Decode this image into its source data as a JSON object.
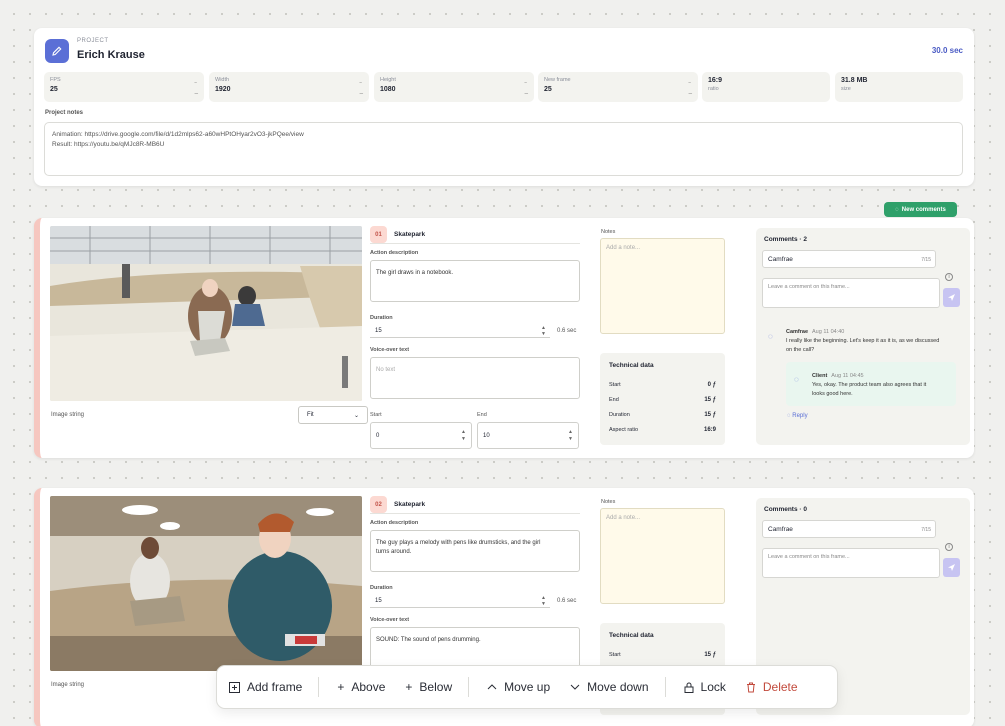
{
  "project": {
    "kicker": "PROJECT",
    "name": "Erich Krause",
    "duration": "30.0 sec",
    "stats": [
      {
        "label": "FPS",
        "value": "25"
      },
      {
        "label": "Width",
        "value": "1920"
      },
      {
        "label": "Height",
        "value": "1080"
      },
      {
        "label": "New frame",
        "value": "25"
      },
      {
        "label": "",
        "value": "16:9",
        "sub": "ratio"
      },
      {
        "label": "",
        "value": "31.8 MB",
        "sub": "size"
      }
    ],
    "notes_label": "Project notes",
    "notes_line1": "Animation: https://drive.google.com/file/d/1d2mlps62-a60wHPtOHyar2vO3-jkPQee/view",
    "notes_line2": "Result: https://youtu.be/qMJc8R-MB6U"
  },
  "new_comments_label": "New comments",
  "frames": [
    {
      "number": "01",
      "title": "Skatepark",
      "action_label": "Action description",
      "action_text": "The girl draws in a notebook.",
      "duration_label": "Duration",
      "duration": "15",
      "duration_sec": "0.6 sec",
      "vo_label": "Voice-over text",
      "vo_text": "No text",
      "start_label": "Start",
      "start": "0",
      "end_label": "End",
      "end": "10",
      "image_string_label": "Image string",
      "fit_option": "Fit",
      "notes_label": "Notes",
      "notes_placeholder": "Add a note...",
      "tech": {
        "title": "Technical data",
        "rows": [
          {
            "label": "Start",
            "value": "0 ƒ"
          },
          {
            "label": "End",
            "value": "15 ƒ"
          },
          {
            "label": "Duration",
            "value": "15 ƒ"
          },
          {
            "label": "Aspect ratio",
            "value": "16:9"
          }
        ]
      },
      "comments": {
        "title": "Comments · 2",
        "author": "Camfrae",
        "author_count": "7/15",
        "placeholder": "Leave a comment on this frame...",
        "thread": [
          {
            "who": "Camfrae",
            "when": "Aug 11 04:40",
            "text1": "I really like the beginning. Let's keep it as it is, as we discussed",
            "text2": "on the call?"
          },
          {
            "who": "Client",
            "when": "Aug 11 04:45",
            "text1": "Yes, okay. The product team also agrees that it",
            "text2": "looks good here."
          }
        ],
        "reply": "Reply"
      }
    },
    {
      "number": "02",
      "title": "Skatepark",
      "action_label": "Action description",
      "action_text1": "The guy plays a melody with pens like drumsticks, and the girl",
      "action_text2": "turns around.",
      "duration_label": "Duration",
      "duration": "15",
      "duration_sec": "0.6 sec",
      "vo_label": "Voice-over text",
      "vo_text": "SOUND: The sound of pens drumming.",
      "image_string_label": "Image string",
      "notes_label": "Notes",
      "notes_placeholder": "Add a note...",
      "tech": {
        "title": "Technical data",
        "rows": [
          {
            "label": "Start",
            "value": "15 ƒ"
          }
        ]
      },
      "comments": {
        "title": "Comments · 0",
        "author": "Camfrae",
        "author_count": "7/15",
        "placeholder": "Leave a comment on this frame..."
      }
    }
  ],
  "toolbar": {
    "add_frame": "Add frame",
    "above": "Above",
    "below": "Below",
    "move_up": "Move up",
    "move_down": "Move down",
    "lock": "Lock",
    "delete": "Delete"
  },
  "colors": {
    "accent": "#5b6fd6",
    "green": "#2fa06a",
    "danger": "#c24a3c",
    "frame_border": "#f6c7c0"
  }
}
